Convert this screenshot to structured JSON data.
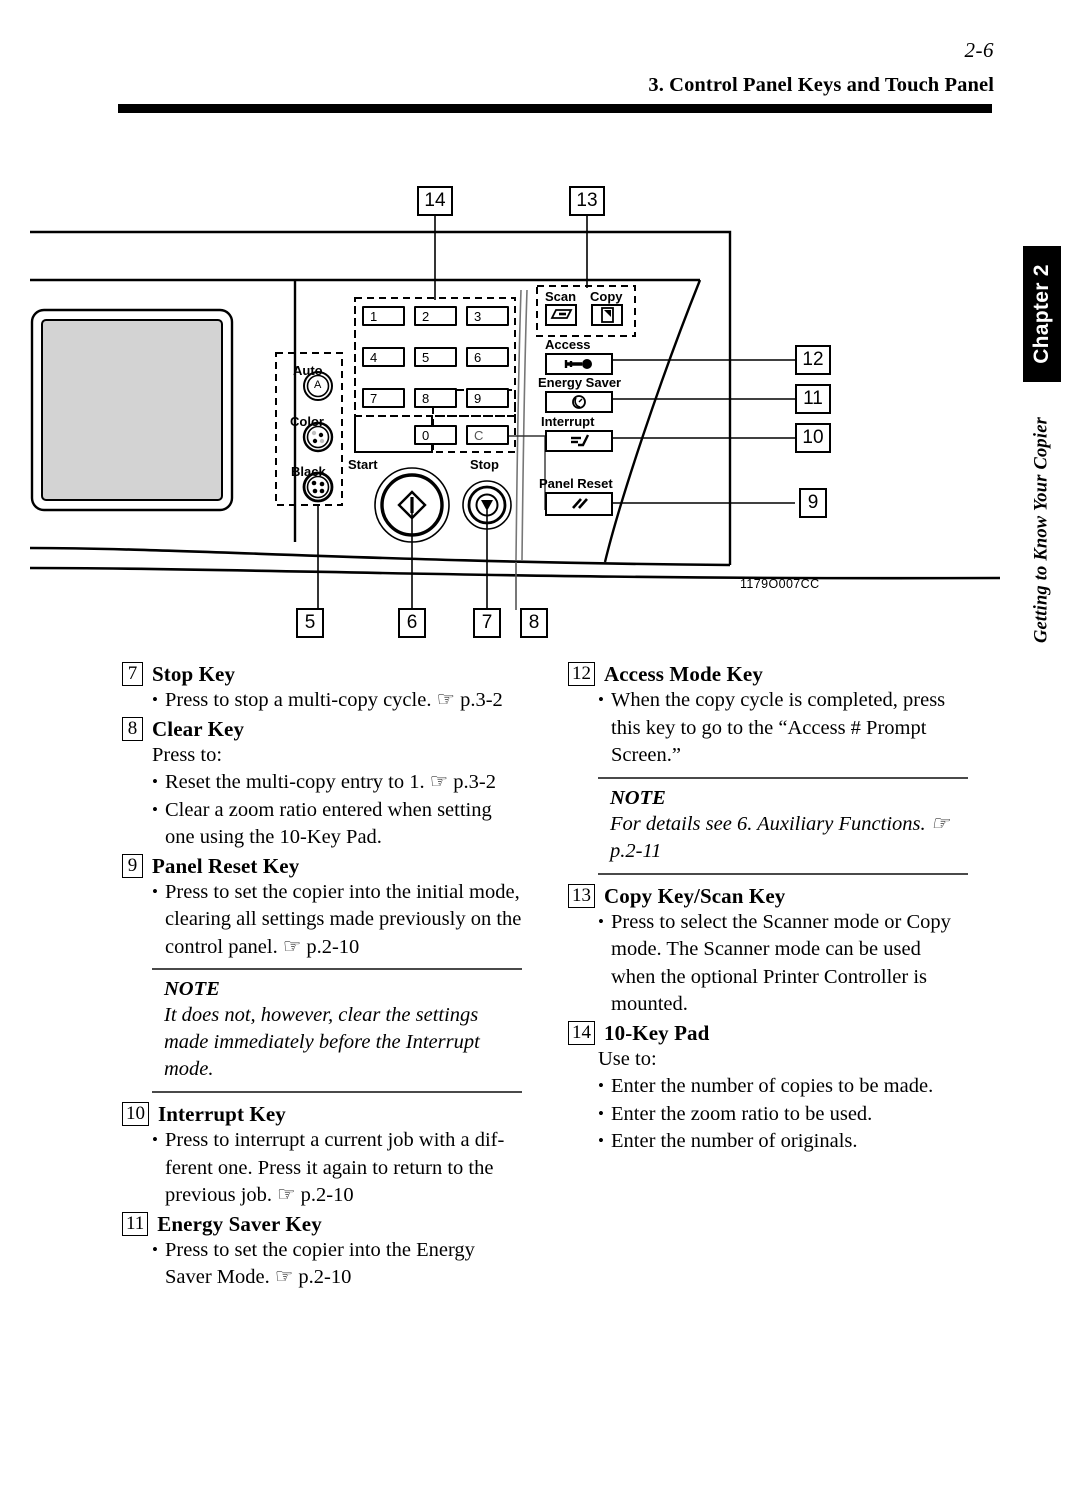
{
  "header": {
    "page_number": "2-6",
    "section_title": "3. Control Panel Keys and Touch Panel"
  },
  "chapter_tab": {
    "label": "Chapter 2",
    "subtitle": "Getting to Know Your Copier"
  },
  "figure": {
    "code": "1179O007CC",
    "callouts": [
      "14",
      "13",
      "12",
      "11",
      "10",
      "9",
      "5",
      "6",
      "7",
      "8"
    ],
    "panel_labels": {
      "auto": "Auto",
      "color": "Color",
      "black": "Black",
      "start": "Start",
      "stop": "Stop",
      "scan": "Scan",
      "copy": "Copy",
      "access": "Access",
      "energy_saver": "Energy Saver",
      "interrupt": "Interrupt",
      "panel_reset": "Panel Reset"
    },
    "keypad_keys": [
      "1",
      "2",
      "3",
      "4",
      "5",
      "6",
      "7",
      "8",
      "9",
      "0",
      "C"
    ],
    "auto_key_glyph": "A",
    "icons": {
      "scan": "scanner-icon",
      "copy": "document-copy-icon",
      "access": "key-icon",
      "energy_saver": "moon-clock-icon",
      "interrupt": "interrupt-arrow-icon",
      "panel_reset": "double-slash-icon",
      "start": "diamond-start-icon",
      "stop": "triangle-stop-icon"
    }
  },
  "left_column": [
    {
      "num": "7",
      "title": "Stop Key",
      "lines": [
        {
          "type": "bullet",
          "text": "Press to stop a multi-copy cycle. ☞ p.3-2"
        }
      ]
    },
    {
      "num": "8",
      "title": "Clear Key",
      "lines": [
        {
          "type": "plain",
          "text": "Press to:"
        },
        {
          "type": "bullet",
          "text": "Reset the multi-copy entry to 1. ☞ p.3-2"
        },
        {
          "type": "bullet",
          "text": "Clear a zoom ratio entered when setting one using the 10-Key Pad."
        }
      ]
    },
    {
      "num": "9",
      "title": "Panel Reset Key",
      "lines": [
        {
          "type": "bullet",
          "text": "Press to set the copier into the initial mode, clearing all settings made previously on the control panel. ☞ p.2-10"
        }
      ],
      "note": {
        "label": "NOTE",
        "text": "It does not, however, clear the settings made immediately before the Interrupt mode."
      }
    },
    {
      "num": "10",
      "title": "Interrupt Key",
      "lines": [
        {
          "type": "bullet",
          "text": "Press to interrupt a current job with a dif-ferent one. Press it again to return to the previous job. ☞ p.2-10"
        }
      ]
    },
    {
      "num": "11",
      "title": "Energy Saver Key",
      "lines": [
        {
          "type": "bullet",
          "text": "Press to set the copier into the Energy Saver Mode. ☞ p.2-10"
        }
      ]
    }
  ],
  "right_column": [
    {
      "num": "12",
      "title": "Access Mode Key",
      "lines": [
        {
          "type": "bullet",
          "text": "When the copy cycle is completed, press this key to go to the “Access # Prompt Screen.”"
        }
      ],
      "note": {
        "label": "NOTE",
        "text": "For details see 6. Auxiliary Functions. ☞ p.2-11"
      }
    },
    {
      "num": "13",
      "title": "Copy Key/Scan Key",
      "lines": [
        {
          "type": "bullet",
          "text": "Press to select the Scanner mode or Copy mode.  The Scanner mode can be used when the optional Printer Controller is mounted."
        }
      ]
    },
    {
      "num": "14",
      "title": "10-Key Pad",
      "lines": [
        {
          "type": "plain",
          "text": "Use to:"
        },
        {
          "type": "bullet",
          "text": "Enter the number of copies to be made."
        },
        {
          "type": "bullet",
          "text": "Enter the zoom ratio to be used."
        },
        {
          "type": "bullet",
          "text": "Enter the number of originals."
        }
      ]
    }
  ]
}
